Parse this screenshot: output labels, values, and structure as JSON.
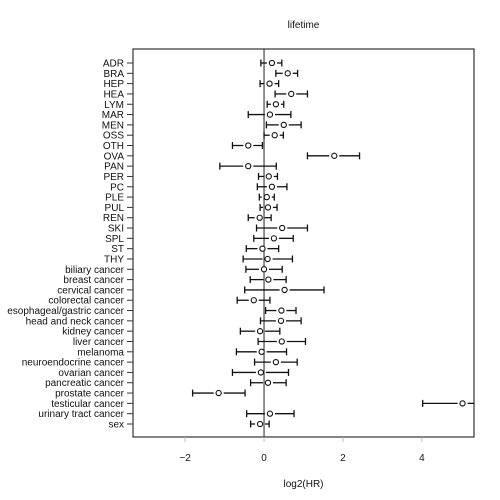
{
  "chart_data": {
    "type": "forest",
    "title": "lifetime",
    "xlabel": "log2(HR)",
    "ylabel": "",
    "xlim": [
      -3.32,
      5.32
    ],
    "x_ticks": [
      -2,
      0,
      2,
      4
    ],
    "x_tick_labels": [
      "−2",
      "0",
      "2",
      "4"
    ],
    "reference_line": 0,
    "grid": false,
    "legend": "none",
    "categories": [
      "ADR",
      "BRA",
      "HEP",
      "HEA",
      "LYM",
      "MAR",
      "MEN",
      "OSS",
      "OTH",
      "OVA",
      "PAN",
      "PER",
      "PC",
      "PLE",
      "PUL",
      "REN",
      "SKI",
      "SPL",
      "ST",
      "THY",
      "biliary cancer",
      "breast cancer",
      "cervical cancer",
      "colorectal cancer",
      "esophageal/gastric cancer",
      "head and neck cancer",
      "kidney cancer",
      "liver cancer",
      "melanoma",
      "neuroendocrine cancer",
      "ovarian cancer",
      "pancreatic cancer",
      "prostate cancer",
      "testicular cancer",
      "urinary tract cancer",
      "sex"
    ],
    "estimate": [
      0.2,
      0.6,
      0.14,
      0.69,
      0.3,
      0.15,
      0.5,
      0.27,
      -0.4,
      1.78,
      -0.4,
      0.12,
      0.2,
      0.07,
      0.1,
      -0.11,
      0.46,
      0.25,
      -0.04,
      0.09,
      0.0,
      0.11,
      0.52,
      -0.26,
      0.44,
      0.43,
      -0.1,
      0.45,
      -0.06,
      0.3,
      -0.08,
      0.1,
      -1.15,
      5.03,
      0.15,
      -0.1
    ],
    "lower": [
      -0.08,
      0.3,
      -0.1,
      0.28,
      0.08,
      -0.4,
      0.06,
      0.0,
      -0.8,
      1.1,
      -1.12,
      -0.14,
      -0.17,
      -0.12,
      -0.1,
      -0.4,
      -0.19,
      -0.26,
      -0.45,
      -0.53,
      -0.46,
      -0.35,
      -0.49,
      -0.68,
      0.04,
      -0.09,
      -0.6,
      -0.15,
      -0.7,
      -0.24,
      -0.8,
      -0.34,
      -1.81,
      4.02,
      -0.44,
      -0.34
    ],
    "upper": [
      0.45,
      0.85,
      0.37,
      1.1,
      0.5,
      0.68,
      0.94,
      0.49,
      -0.04,
      2.42,
      0.31,
      0.34,
      0.58,
      0.26,
      0.33,
      0.18,
      1.1,
      0.74,
      0.37,
      0.72,
      0.46,
      0.56,
      1.52,
      0.15,
      0.81,
      0.94,
      0.4,
      1.05,
      0.57,
      0.84,
      0.62,
      0.56,
      -0.48,
      6.0,
      0.76,
      0.13
    ]
  }
}
